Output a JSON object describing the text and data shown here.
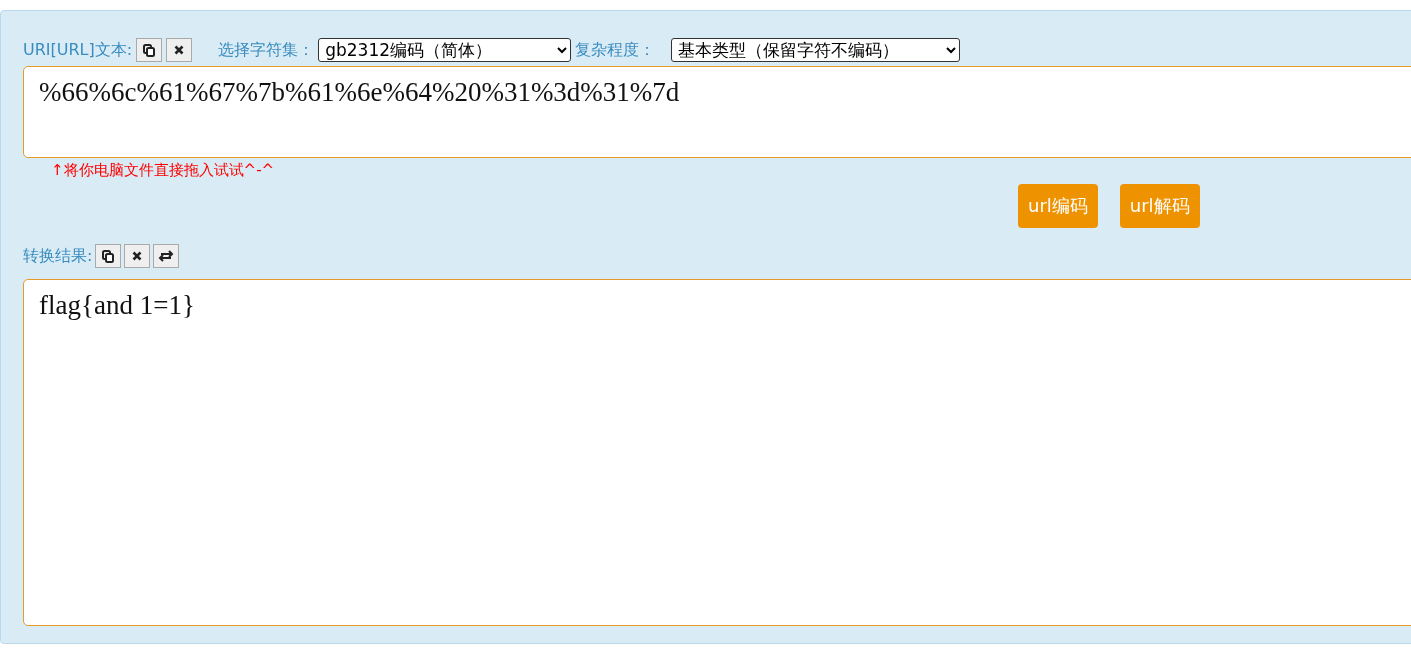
{
  "source": {
    "label": "URI[URL]文本:",
    "value": "%66%6c%61%67%7b%61%6e%64%20%31%3d%31%7d"
  },
  "charset": {
    "label": "选择字符集：",
    "value": "gb2312编码（简体）"
  },
  "complexity": {
    "label": "复杂程度：",
    "value": "基本类型（保留字符不编码）"
  },
  "hint": "↑将你电脑文件直接拖入试试^-^",
  "buttons": [
    "url编码",
    "url解码"
  ],
  "result": {
    "label": "转换结果:",
    "value": "flag{and 1=1}"
  }
}
